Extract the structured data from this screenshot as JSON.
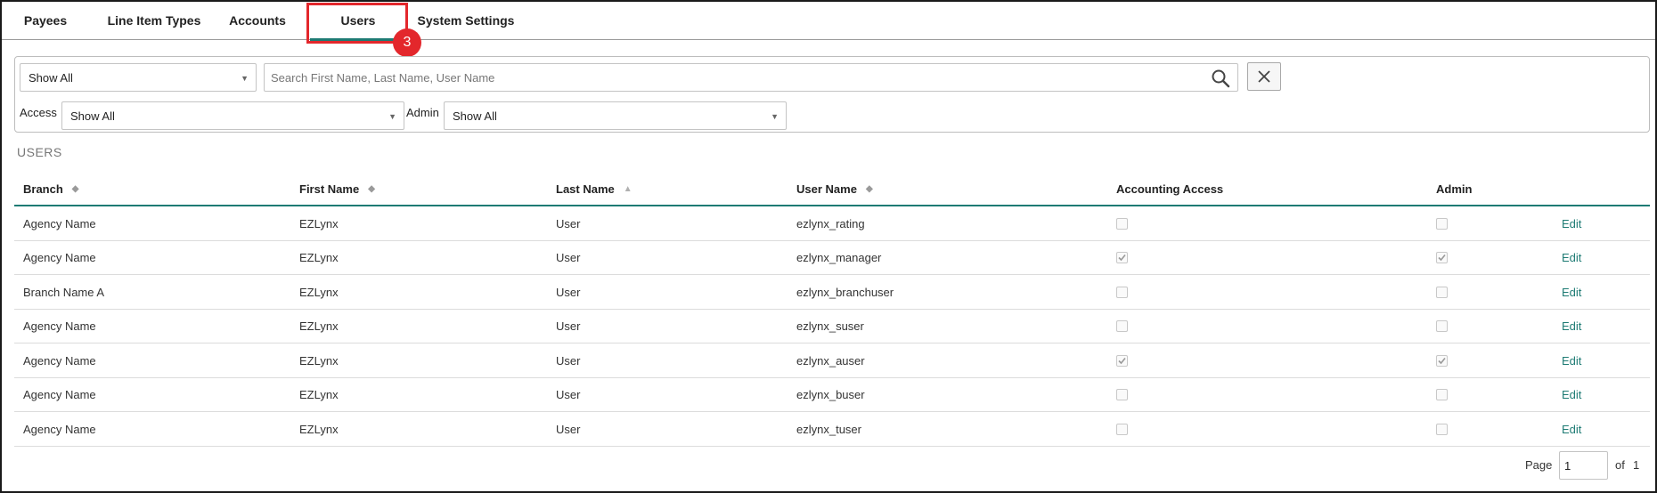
{
  "tabs": [
    {
      "label": "Payees"
    },
    {
      "label": "Line Item Types"
    },
    {
      "label": "Accounts"
    },
    {
      "label": "Users"
    },
    {
      "label": "System Settings"
    }
  ],
  "active_tab": "Users",
  "annotation": {
    "step_number": "3",
    "color": "#e3272c"
  },
  "filters": {
    "branch_select": "Show All",
    "search_placeholder": "Search First Name, Last Name, User Name",
    "access_label": "Access",
    "access_select": "Show All",
    "admin_label": "Admin",
    "admin_select": "Show All"
  },
  "section_title": "USERS",
  "table": {
    "columns": [
      "Branch",
      "First Name",
      "Last Name",
      "User Name",
      "Accounting Access",
      "Admin"
    ],
    "rows": [
      {
        "branch": "Agency Name",
        "first": "EZLynx",
        "last": "User",
        "username": "ezlynx_rating",
        "accounting": false,
        "admin": false,
        "action": "Edit"
      },
      {
        "branch": "Agency Name",
        "first": "EZLynx",
        "last": "User",
        "username": "ezlynx_manager",
        "accounting": true,
        "admin": true,
        "action": "Edit"
      },
      {
        "branch": "Branch Name A",
        "first": "EZLynx",
        "last": "User",
        "username": "ezlynx_branchuser",
        "accounting": false,
        "admin": false,
        "action": "Edit"
      },
      {
        "branch": "Agency Name",
        "first": "EZLynx",
        "last": "User",
        "username": "ezlynx_suser",
        "accounting": false,
        "admin": false,
        "action": "Edit"
      },
      {
        "branch": "Agency Name",
        "first": "EZLynx",
        "last": "User",
        "username": "ezlynx_auser",
        "accounting": true,
        "admin": true,
        "action": "Edit"
      },
      {
        "branch": "Agency Name",
        "first": "EZLynx",
        "last": "User",
        "username": "ezlynx_buser",
        "accounting": false,
        "admin": false,
        "action": "Edit"
      },
      {
        "branch": "Agency Name",
        "first": "EZLynx",
        "last": "User",
        "username": "ezlynx_tuser",
        "accounting": false,
        "admin": false,
        "action": "Edit"
      }
    ]
  },
  "pagination": {
    "page_label": "Page",
    "current_page": "1",
    "of_label": "of",
    "total_pages": "1"
  },
  "colors": {
    "accent": "#1e7b74",
    "highlight": "#e3272c"
  }
}
